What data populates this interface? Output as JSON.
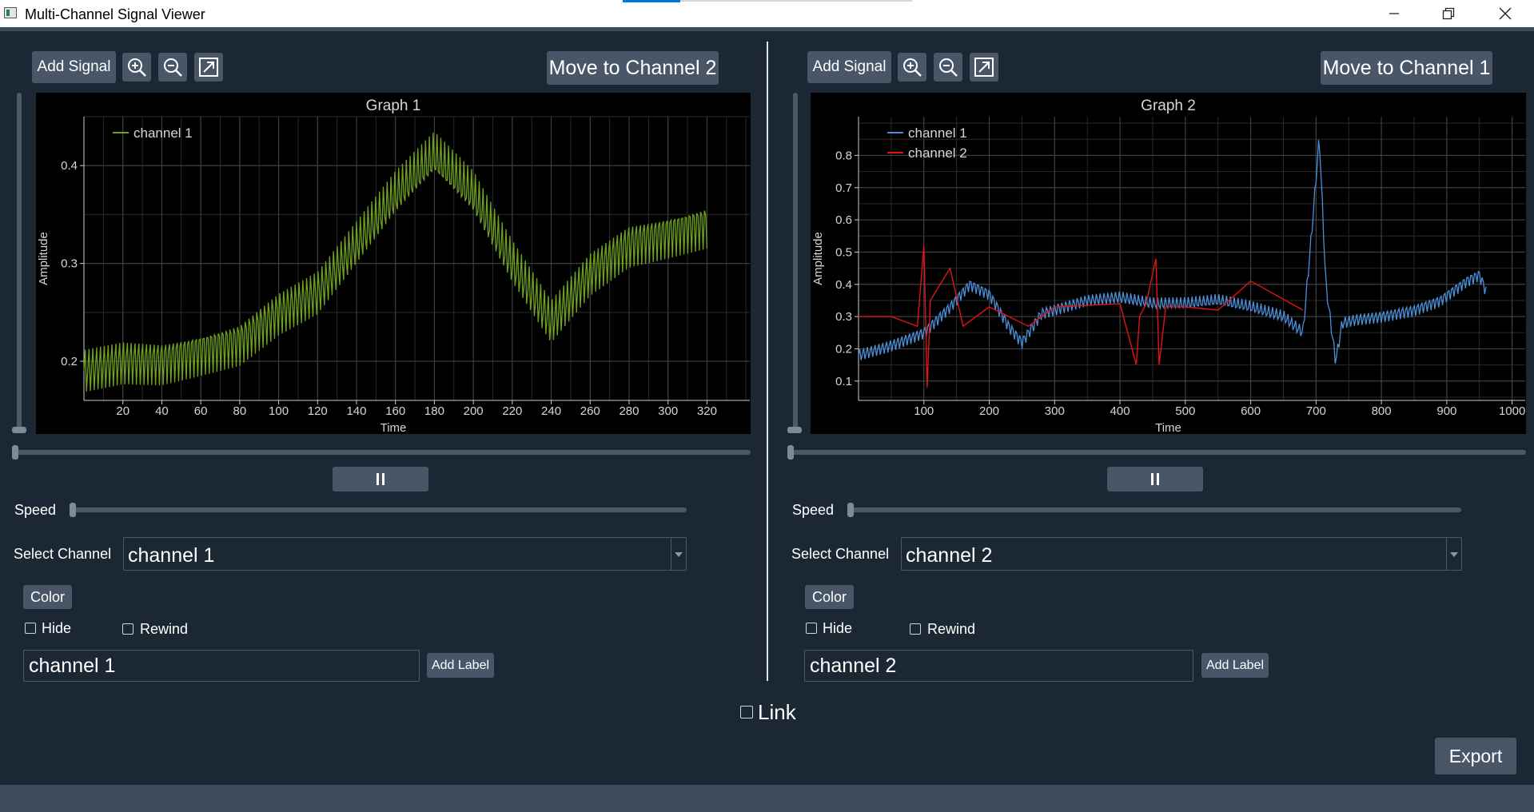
{
  "window": {
    "title": "Multi-Channel Signal Viewer",
    "controls": [
      "minimize-icon",
      "restore-icon",
      "close-icon"
    ]
  },
  "panels": [
    {
      "add_signal_label": "Add Signal",
      "move_label": "Move to Channel 2",
      "speed_label": "Speed",
      "select_channel_label": "Select Channel",
      "selected_channel": "channel 1",
      "color_label": "Color",
      "hide_label": "Hide",
      "rewind_label": "Rewind",
      "label_input_value": "channel 1",
      "add_label_label": "Add Label",
      "graph_title": "Graph 1",
      "xlabel": "Time",
      "ylabel": "Amplitude",
      "legend": [
        "channel 1"
      ]
    },
    {
      "add_signal_label": "Add Signal",
      "move_label": "Move to Channel 1",
      "speed_label": "Speed",
      "select_channel_label": "Select Channel",
      "selected_channel": "channel 2",
      "color_label": "Color",
      "hide_label": "Hide",
      "rewind_label": "Rewind",
      "label_input_value": "channel 2",
      "add_label_label": "Add Label",
      "graph_title": "Graph 2",
      "xlabel": "Time",
      "ylabel": "Amplitude",
      "legend": [
        "channel 1",
        "channel 2"
      ]
    }
  ],
  "link_label": "Link",
  "export_label": "Export",
  "colors": {
    "background": "#1c2734",
    "button": "#485668",
    "series_green": "#6ea21c",
    "series_blue": "#4a90d9",
    "series_red": "#e01414"
  },
  "chart_data": [
    {
      "type": "line",
      "title": "Graph 1",
      "xlabel": "Time",
      "ylabel": "Amplitude",
      "xlim": [
        0,
        342
      ],
      "ylim": [
        0.16,
        0.45
      ],
      "xticks": [
        20,
        40,
        60,
        80,
        100,
        120,
        140,
        160,
        180,
        200,
        220,
        240,
        260,
        280,
        300,
        320
      ],
      "yticks": [
        0.2,
        0.3,
        0.4
      ],
      "grid": true,
      "legend_position": "top-left",
      "series": [
        {
          "name": "channel 1",
          "color": "#6ea21c",
          "x": [
            0,
            20,
            40,
            60,
            80,
            100,
            120,
            140,
            160,
            180,
            200,
            220,
            240,
            260,
            280,
            300,
            320
          ],
          "y": [
            0.19,
            0.2,
            0.2,
            0.21,
            0.22,
            0.25,
            0.27,
            0.32,
            0.37,
            0.41,
            0.37,
            0.3,
            0.24,
            0.29,
            0.32,
            0.33,
            0.34
          ],
          "oscillation_amplitude": 0.025
        }
      ]
    },
    {
      "type": "line",
      "title": "Graph 2",
      "xlabel": "Time",
      "ylabel": "Amplitude",
      "xlim": [
        0,
        1020
      ],
      "ylim": [
        0.04,
        0.92
      ],
      "xticks": [
        100,
        200,
        300,
        400,
        500,
        600,
        700,
        800,
        900,
        1000
      ],
      "yticks": [
        0.1,
        0.2,
        0.3,
        0.4,
        0.5,
        0.6,
        0.7,
        0.8
      ],
      "grid": true,
      "legend_position": "top-left",
      "series": [
        {
          "name": "channel 1",
          "color": "#4a90d9",
          "x": [
            0,
            50,
            100,
            140,
            170,
            200,
            230,
            250,
            280,
            350,
            400,
            450,
            500,
            550,
            600,
            650,
            680,
            695,
            705,
            715,
            730,
            740,
            760,
            800,
            850,
            890,
            930,
            950,
            960
          ],
          "y": [
            0.18,
            0.21,
            0.25,
            0.33,
            0.4,
            0.37,
            0.27,
            0.22,
            0.31,
            0.35,
            0.36,
            0.34,
            0.34,
            0.35,
            0.33,
            0.3,
            0.25,
            0.6,
            0.86,
            0.4,
            0.16,
            0.28,
            0.29,
            0.3,
            0.32,
            0.35,
            0.41,
            0.43,
            0.38
          ],
          "oscillation_amplitude": 0.02
        },
        {
          "name": "channel 2",
          "color": "#e01414",
          "x": [
            0,
            50,
            90,
            100,
            105,
            110,
            140,
            160,
            200,
            260,
            300,
            400,
            425,
            430,
            440,
            455,
            460,
            470,
            500,
            550,
            600,
            680
          ],
          "y": [
            0.3,
            0.3,
            0.27,
            0.52,
            0.08,
            0.35,
            0.45,
            0.27,
            0.33,
            0.27,
            0.33,
            0.34,
            0.15,
            0.3,
            0.34,
            0.48,
            0.15,
            0.33,
            0.33,
            0.32,
            0.41,
            0.32
          ],
          "oscillation_amplitude": 0.0
        }
      ]
    }
  ]
}
